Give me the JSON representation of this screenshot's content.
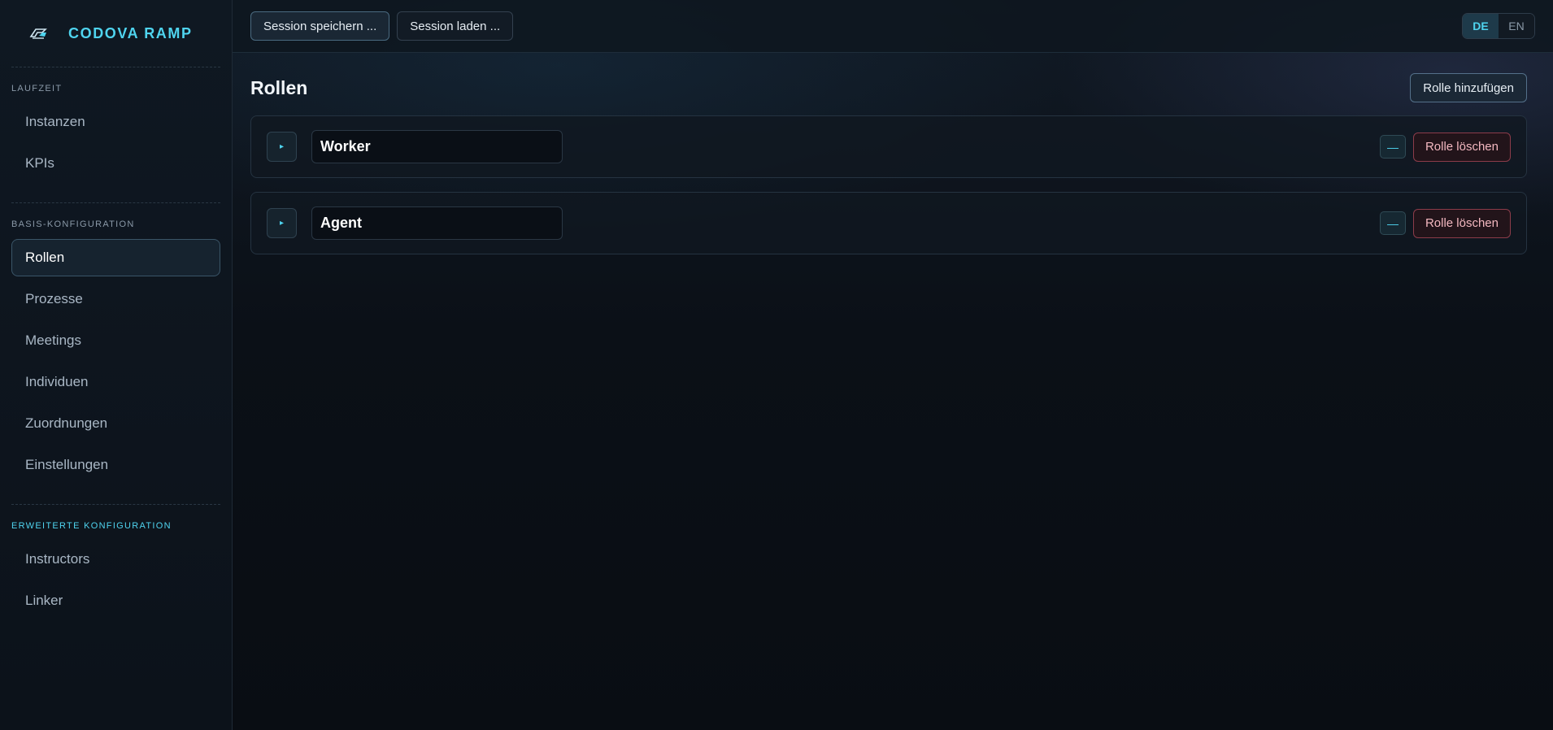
{
  "brand": {
    "name": "CODOVA RAMP",
    "logo_icon": "ramp-logo-icon",
    "accent_color": "#4fd4ef"
  },
  "sidebar": {
    "sections": [
      {
        "label": "LAUFZEIT",
        "items": [
          {
            "label": "Instanzen"
          },
          {
            "label": "KPIs"
          }
        ]
      },
      {
        "label": "BASIS-KONFIGURATION",
        "items": [
          {
            "label": "Rollen",
            "active": true
          },
          {
            "label": "Prozesse"
          },
          {
            "label": "Meetings"
          },
          {
            "label": "Individuen"
          },
          {
            "label": "Zuordnungen"
          },
          {
            "label": "Einstellungen"
          }
        ]
      },
      {
        "label": "ERWEITERTE KONFIGURATION",
        "items": [
          {
            "label": "Instructors"
          },
          {
            "label": "Linker"
          }
        ]
      }
    ]
  },
  "topbar": {
    "save_session": "Session speichern ...",
    "load_session": "Session laden ...",
    "languages": [
      {
        "code": "DE",
        "active": true
      },
      {
        "code": "EN",
        "active": false
      }
    ]
  },
  "page": {
    "title": "Rollen",
    "add_button": "Rolle hinzufügen",
    "roles": [
      {
        "name": "Worker",
        "expand_icon": "▸",
        "collapse_icon": "—",
        "delete_label": "Rolle löschen"
      },
      {
        "name": "Agent",
        "expand_icon": "▸",
        "collapse_icon": "—",
        "delete_label": "Rolle löschen"
      }
    ]
  },
  "colors": {
    "danger": "#8c3c4a",
    "danger_text": "#f3b8c0",
    "active_nav_border": "#3a5568"
  }
}
